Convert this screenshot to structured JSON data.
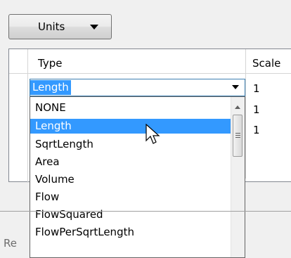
{
  "toolbar": {
    "units_label": "Units"
  },
  "grid": {
    "columns": [
      "Type",
      "Scale"
    ],
    "scale_values": [
      "1",
      "1",
      "1"
    ]
  },
  "type_combo": {
    "selected": "Length",
    "options": [
      "NONE",
      "Length",
      "SqrtLength",
      "Area",
      "Volume",
      "Flow",
      "FlowSquared",
      "FlowPerSqrtLength"
    ],
    "highlighted": "Length"
  },
  "footer": {
    "partial_label": "Re"
  },
  "colors": {
    "selection": "#3399ff",
    "grid_border": "#828790"
  }
}
